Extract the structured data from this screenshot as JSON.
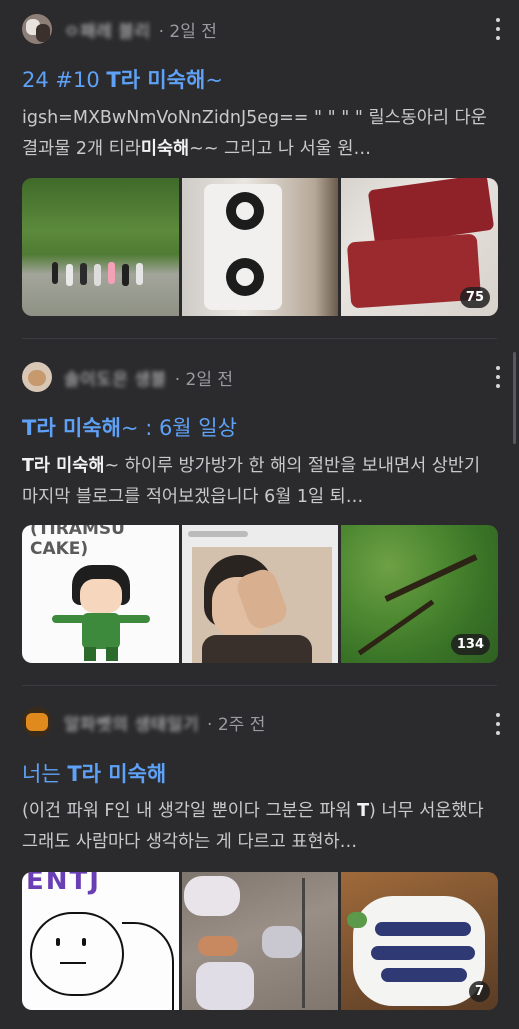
{
  "posts": [
    {
      "author": "ㅇ패레 블리",
      "time": "· 2일 전",
      "title_pre": "24 #10 ",
      "title_bold": "T라 미숙해",
      "title_post": "~",
      "snippet_a": "igsh=MXBwNmVoNnZidnJ5eg== \" \" \" \" 릴스동아리 다운 결과물 2개 티라",
      "snippet_bold": "미숙해",
      "snippet_b": "~~ 그리고 나 서울 원…",
      "image_count": "75",
      "images": [
        "group-photo-forest",
        "air-purifier",
        "raw-beef-packs"
      ]
    },
    {
      "author": "솔이도은 생블",
      "time": "· 2일 전",
      "title_pre": "",
      "title_bold": "T라 미숙해",
      "title_post": "~ : 6월 일상",
      "snippet_a": "",
      "snippet_bold": "T라 미숙해",
      "snippet_b": "~ 하이루 방가방가 한 해의 절반을 보내면서 상반기 마지막 블로그를 적어보겠읍니다 6월 1일 퇴…",
      "image_count": "134",
      "images": [
        "tiramisu-cake-gon-illustration",
        "man-covering-face",
        "green-tree-leaves"
      ],
      "tiramisu_text": "(TIRAMSU\nCAKE)"
    },
    {
      "author": "알파벳의 생태일기",
      "time": "· 2주 전",
      "title_pre": "너는 ",
      "title_bold": "T라 미숙해",
      "title_post": "",
      "snippet_a": "(이건 파워 F인 내 생각일 뿐이다 그분은 파워 ",
      "snippet_bold": "T",
      "snippet_b": ") 너무 서운했다 그래도 사람마다 생각하는 게 다르고 표현하…",
      "image_count": "7",
      "images": [
        "entj-doodle",
        "feet-slippers-floor",
        "blueberry-cake"
      ],
      "entj_text": "ENTJ"
    }
  ]
}
